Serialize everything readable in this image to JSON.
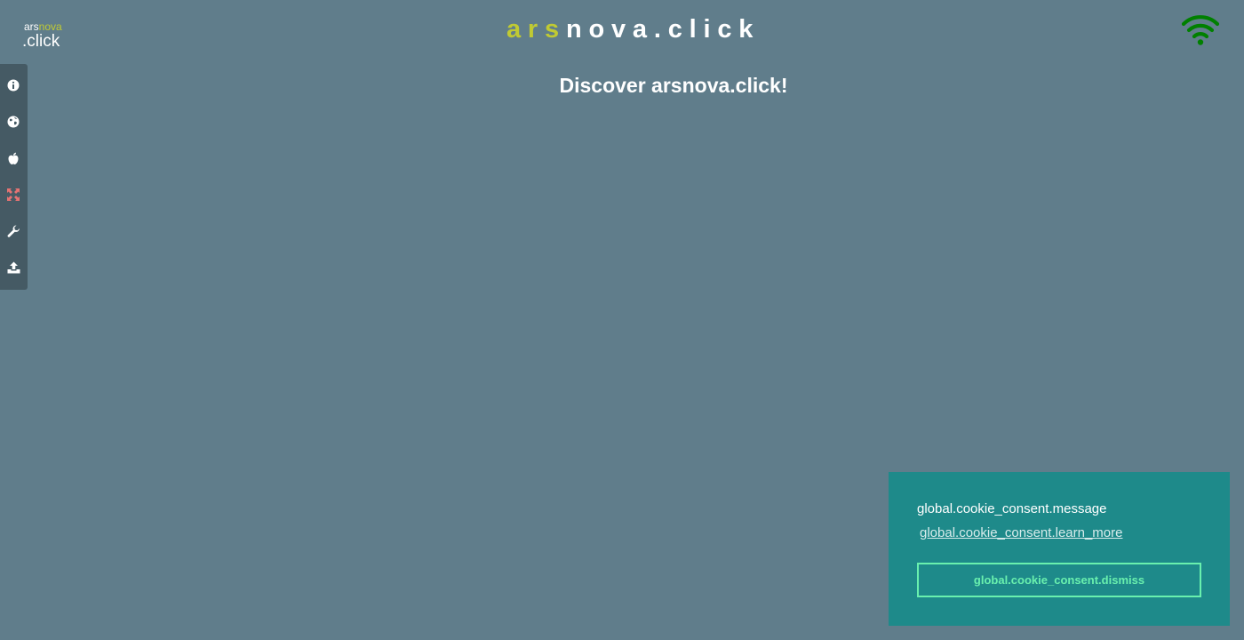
{
  "logo": {
    "line1_plain": "ars",
    "line1_accent": "nova",
    "line2": ".click"
  },
  "header": {
    "title_accent": "ars",
    "title_rest": "nova.click",
    "status_icon": "wifi-icon",
    "status_color": "#008000"
  },
  "sidebar": {
    "items": [
      {
        "icon": "info-icon"
      },
      {
        "icon": "globe-icon"
      },
      {
        "icon": "apple-icon"
      },
      {
        "icon": "expand-icon",
        "color": "#e57373"
      },
      {
        "icon": "wrench-icon"
      },
      {
        "icon": "upload-icon"
      }
    ]
  },
  "main": {
    "headline": "Discover arsnova.click!"
  },
  "cookie_consent": {
    "message": "global.cookie_consent.message",
    "learn_more": "global.cookie_consent.learn_more",
    "dismiss": "global.cookie_consent.dismiss"
  },
  "colors": {
    "background": "#607d8b",
    "sidebar": "#455a64",
    "accent": "#c0ca33",
    "cookie_background": "#1e8a8a",
    "cookie_button": "#69f0ae"
  }
}
